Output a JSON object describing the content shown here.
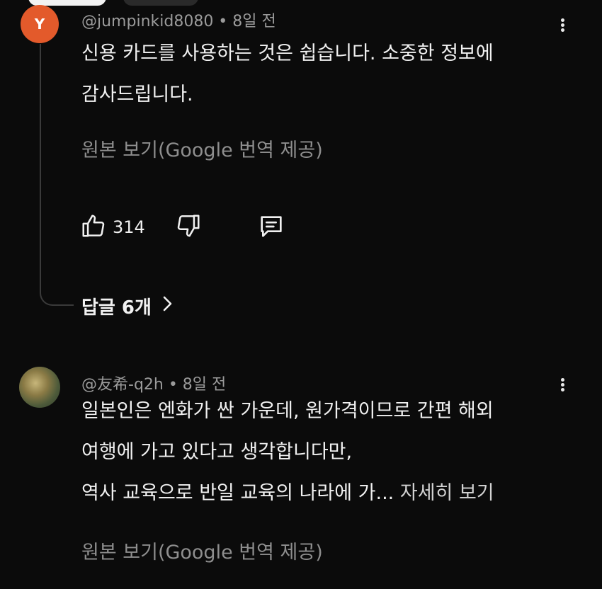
{
  "comment1": {
    "avatar_letter": "Y",
    "meta": "@jumpinkid8080 • 8일 전",
    "lines": [
      "신용 카드를 사용하는 것은 쉽습니다. 소중한 정보에",
      "감사드립니다."
    ],
    "translate": "원본 보기(Google 번역 제공)",
    "like_count": "314",
    "replies": "답글 6개"
  },
  "comment2": {
    "meta": "@友希-q2h • 8일 전",
    "lines": [
      "일본인은 엔화가 싼 가운데, 원가격이므로 간편 해외",
      "여행에 가고 있다고 생각합니다만,"
    ],
    "last_line": "역사 교육으로 반일 교육의 나라에 가...",
    "see_more": "자세히 보기",
    "translate": "원본 보기(Google 번역 제공)"
  },
  "icons": {
    "like": "thumbs-up-icon",
    "dislike": "thumbs-down-icon",
    "reply": "comment-icon",
    "more": "more-vert-icon",
    "expand": "chevron-right-icon"
  }
}
